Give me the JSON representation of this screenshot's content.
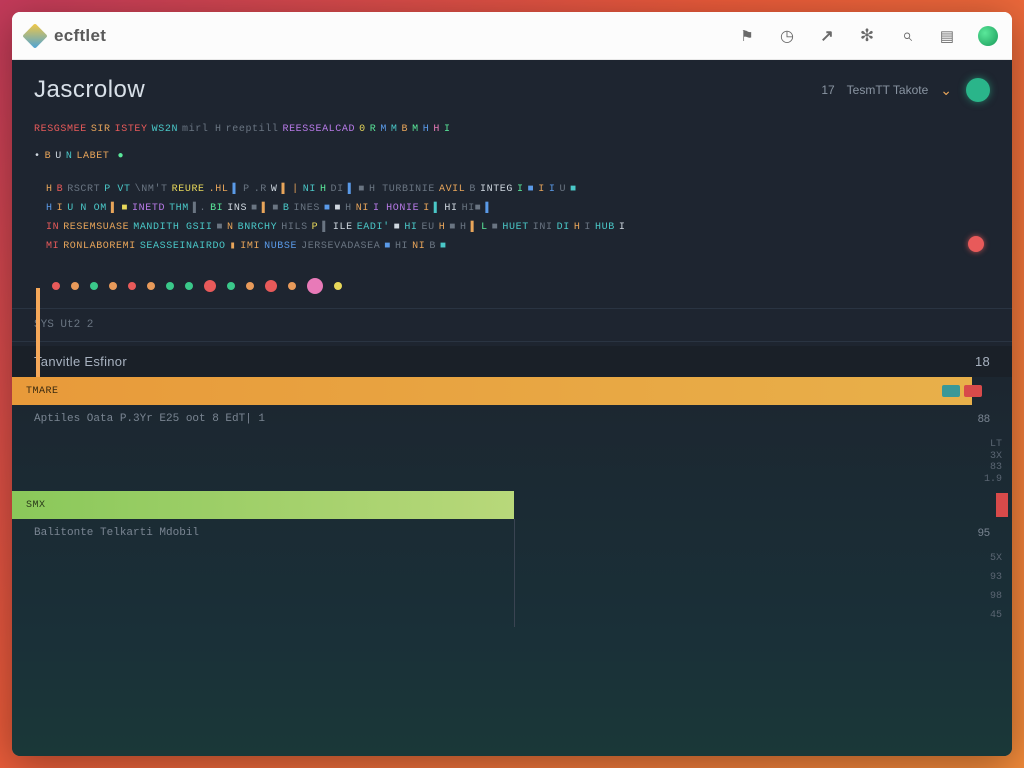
{
  "app": {
    "name": "ecftlet"
  },
  "header": {
    "project": "Jascrolow",
    "mode_prefix": "17",
    "mode_label": "TesmTT Takote",
    "dot_color": "#2ab58a"
  },
  "code": {
    "line1": [
      {
        "t": "RESGSMEE",
        "c": "red"
      },
      {
        "t": "SIR",
        "c": "orange"
      },
      {
        "t": "ISTEY",
        "c": "red"
      },
      {
        "t": "WS2N",
        "c": "teal"
      },
      {
        "t": "mirl H",
        "c": "gray"
      },
      {
        "t": "reeptill",
        "c": "gray"
      },
      {
        "t": "REESSEALCAD",
        "c": "purple"
      },
      {
        "t": "0",
        "c": "yellow"
      },
      {
        "t": "R",
        "c": "green"
      },
      {
        "t": "M",
        "c": "blue"
      },
      {
        "t": "M",
        "c": "teal"
      },
      {
        "t": "B",
        "c": "orange"
      },
      {
        "t": "M",
        "c": "green"
      },
      {
        "t": "H",
        "c": "blue"
      },
      {
        "t": "H",
        "c": "pink"
      },
      {
        "t": "I",
        "c": "green"
      }
    ],
    "line2": [
      {
        "t": "•",
        "c": "white"
      },
      {
        "t": "B",
        "c": "orange"
      },
      {
        "t": "U",
        "c": "white"
      },
      {
        "t": "N",
        "c": "teal"
      },
      {
        "t": "LABET",
        "c": "orange"
      },
      {
        "t": "",
        "c": "gray"
      },
      {
        "t": "●",
        "c": "green"
      }
    ],
    "block": [
      [
        {
          "t": "H",
          "c": "orange"
        },
        {
          "t": "B",
          "c": "red"
        },
        {
          "t": "RSCRT",
          "c": "gray"
        },
        {
          "t": "P VT",
          "c": "teal"
        },
        {
          "t": "\\NM'T",
          "c": "gray"
        },
        {
          "t": "REURE",
          "c": "yellow"
        },
        {
          "t": ".HL",
          "c": "orange"
        },
        {
          "t": "▌",
          "c": "blue"
        },
        {
          "t": "P",
          "c": "gray"
        },
        {
          "t": ".R",
          "c": "gray"
        },
        {
          "t": "W",
          "c": "white"
        },
        {
          "t": "▌",
          "c": "orange"
        },
        {
          "t": "|",
          "c": "orange"
        },
        {
          "t": "NI",
          "c": "teal"
        },
        {
          "t": "H",
          "c": "green"
        },
        {
          "t": "DI",
          "c": "gray"
        },
        {
          "t": "▌",
          "c": "blue"
        },
        {
          "t": "■",
          "c": "gray"
        },
        {
          "t": "H TURBINIE",
          "c": "gray"
        },
        {
          "t": "AVIL",
          "c": "orange"
        },
        {
          "t": "B",
          "c": "gray"
        },
        {
          "t": "INTEG",
          "c": "white"
        },
        {
          "t": "I",
          "c": "green"
        },
        {
          "t": "■",
          "c": "blue"
        },
        {
          "t": "I",
          "c": "orange"
        },
        {
          "t": "I",
          "c": "blue"
        },
        {
          "t": "U",
          "c": "gray"
        },
        {
          "t": "■",
          "c": "teal"
        }
      ],
      [
        {
          "t": "H",
          "c": "blue"
        },
        {
          "t": "I",
          "c": "orange"
        },
        {
          "t": "U N OM",
          "c": "teal"
        },
        {
          "t": "▌",
          "c": "orange"
        },
        {
          "t": "■",
          "c": "yellow"
        },
        {
          "t": "INETD",
          "c": "purple"
        },
        {
          "t": "THM",
          "c": "teal"
        },
        {
          "t": "▌.",
          "c": "gray"
        },
        {
          "t": "BI",
          "c": "green"
        },
        {
          "t": "INS",
          "c": "white"
        },
        {
          "t": "■",
          "c": "gray"
        },
        {
          "t": "▌",
          "c": "orange"
        },
        {
          "t": "■",
          "c": "gray"
        },
        {
          "t": "B",
          "c": "teal"
        },
        {
          "t": "INES",
          "c": "gray"
        },
        {
          "t": "■",
          "c": "blue"
        },
        {
          "t": "■",
          "c": "white"
        },
        {
          "t": "H",
          "c": "gray"
        },
        {
          "t": "NI",
          "c": "orange"
        },
        {
          "t": "I HONIE",
          "c": "purple"
        },
        {
          "t": "I",
          "c": "orange"
        },
        {
          "t": "▌",
          "c": "teal"
        },
        {
          "t": "HI",
          "c": "white"
        },
        {
          "t": "HI■",
          "c": "gray"
        },
        {
          "t": "▌",
          "c": "blue"
        }
      ],
      [
        {
          "t": "IN",
          "c": "red"
        },
        {
          "t": "RESEMSUASE",
          "c": "orange"
        },
        {
          "t": "MANDITH GSII",
          "c": "teal"
        },
        {
          "t": "■",
          "c": "gray"
        },
        {
          "t": "N",
          "c": "orange"
        },
        {
          "t": "BNRCHY",
          "c": "teal"
        },
        {
          "t": "HILS",
          "c": "gray"
        },
        {
          "t": "P",
          "c": "yellow"
        },
        {
          "t": "▌",
          "c": "gray"
        },
        {
          "t": "ILE",
          "c": "white"
        },
        {
          "t": "EADI'",
          "c": "teal"
        },
        {
          "t": "■",
          "c": "white"
        },
        {
          "t": "HI",
          "c": "teal"
        },
        {
          "t": "EU",
          "c": "gray"
        },
        {
          "t": "H",
          "c": "orange"
        },
        {
          "t": "■",
          "c": "gray"
        },
        {
          "t": "H",
          "c": "gray"
        },
        {
          "t": "▌",
          "c": "orange"
        },
        {
          "t": "L",
          "c": "green"
        },
        {
          "t": "■",
          "c": "gray"
        },
        {
          "t": "HUET",
          "c": "teal"
        },
        {
          "t": "INI",
          "c": "gray"
        },
        {
          "t": "DI",
          "c": "teal"
        },
        {
          "t": "H",
          "c": "orange"
        },
        {
          "t": "I",
          "c": "gray"
        },
        {
          "t": "HUB",
          "c": "teal"
        },
        {
          "t": "I",
          "c": "white"
        }
      ],
      [
        {
          "t": "MI",
          "c": "red"
        },
        {
          "t": "RONLABOREMI",
          "c": "orange"
        },
        {
          "t": "SEASSEINAIRDO",
          "c": "teal"
        },
        {
          "t": "▮",
          "c": "orange"
        },
        {
          "t": "IMI",
          "c": "orange"
        },
        {
          "t": "NUBSE",
          "c": "blue"
        },
        {
          "t": "JERSEVADASEA",
          "c": "gray"
        },
        {
          "t": "■",
          "c": "blue"
        },
        {
          "t": "HI",
          "c": "gray"
        },
        {
          "t": "NI",
          "c": "orange"
        },
        {
          "t": "B",
          "c": "gray"
        },
        {
          "t": "■",
          "c": "teal"
        }
      ]
    ]
  },
  "dots": [
    "red",
    "orange",
    "green",
    "orange",
    "red",
    "orange",
    "green",
    "green",
    "red",
    "green",
    "orange",
    "red",
    "orange",
    "pink",
    "yellow"
  ],
  "status": {
    "text": "SYS Ut2 2"
  },
  "profiler": {
    "title": "Tanvitle Esfinor",
    "count": "18",
    "rows": [
      {
        "label": "TMARE",
        "color": "orange",
        "value": ""
      },
      {
        "label": "Aptiles Oata P.3Yr  E25  oot 8 EdT| 1",
        "color": "none",
        "value": "88"
      },
      {
        "label": "SMX",
        "color": "green",
        "value": ""
      },
      {
        "label": "Balitonte Telkarti Mdobil",
        "color": "none",
        "value": "95"
      }
    ],
    "side_marks": [
      "LT",
      "3X",
      "83",
      "1.9",
      "5X",
      "93",
      "98",
      "45"
    ]
  }
}
